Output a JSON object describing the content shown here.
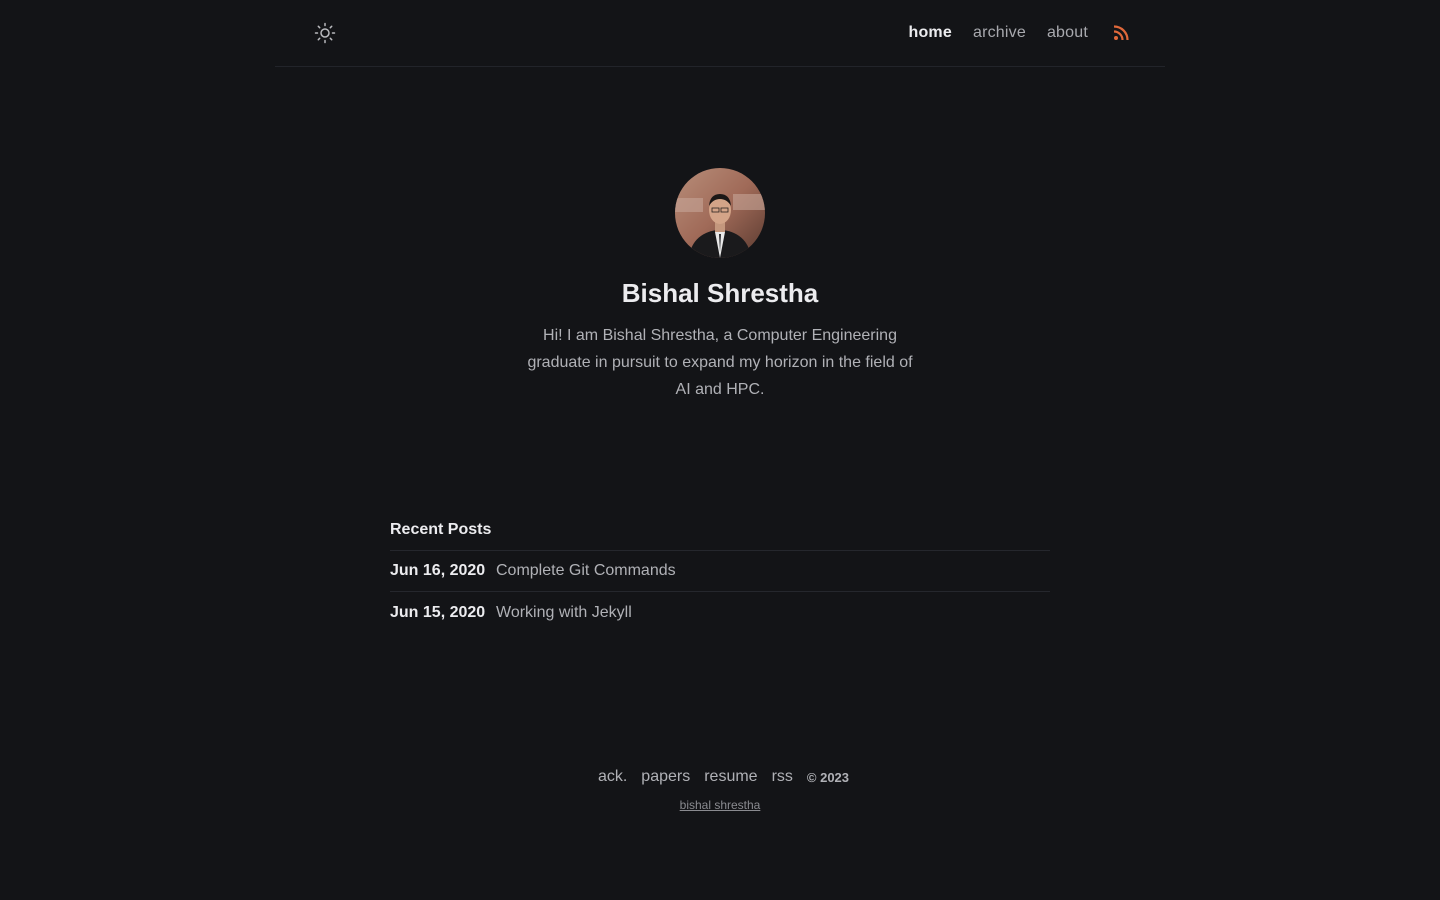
{
  "header": {
    "theme_icon": "sun-icon",
    "nav": [
      {
        "label": "home",
        "active": true
      },
      {
        "label": "archive",
        "active": false
      },
      {
        "label": "about",
        "active": false
      }
    ],
    "rss_icon": "rss-icon",
    "rss_color": "#e0683a"
  },
  "profile": {
    "name": "Bishal Shrestha",
    "bio": "Hi! I am Bishal Shrestha, a Computer Engineering graduate in pursuit to expand my horizon in the field of AI and HPC."
  },
  "posts": {
    "title": "Recent Posts",
    "items": [
      {
        "date": "Jun 16, 2020",
        "title": "Complete Git Commands"
      },
      {
        "date": "Jun 15, 2020",
        "title": "Working with Jekyll"
      }
    ]
  },
  "footer": {
    "links": [
      "ack.",
      "papers",
      "resume",
      "rss"
    ],
    "copyright": "© 2023",
    "author": "bishal shrestha"
  },
  "colors": {
    "background": "#131417",
    "text_primary": "#ececef",
    "text_secondary": "#b0b1b6"
  }
}
